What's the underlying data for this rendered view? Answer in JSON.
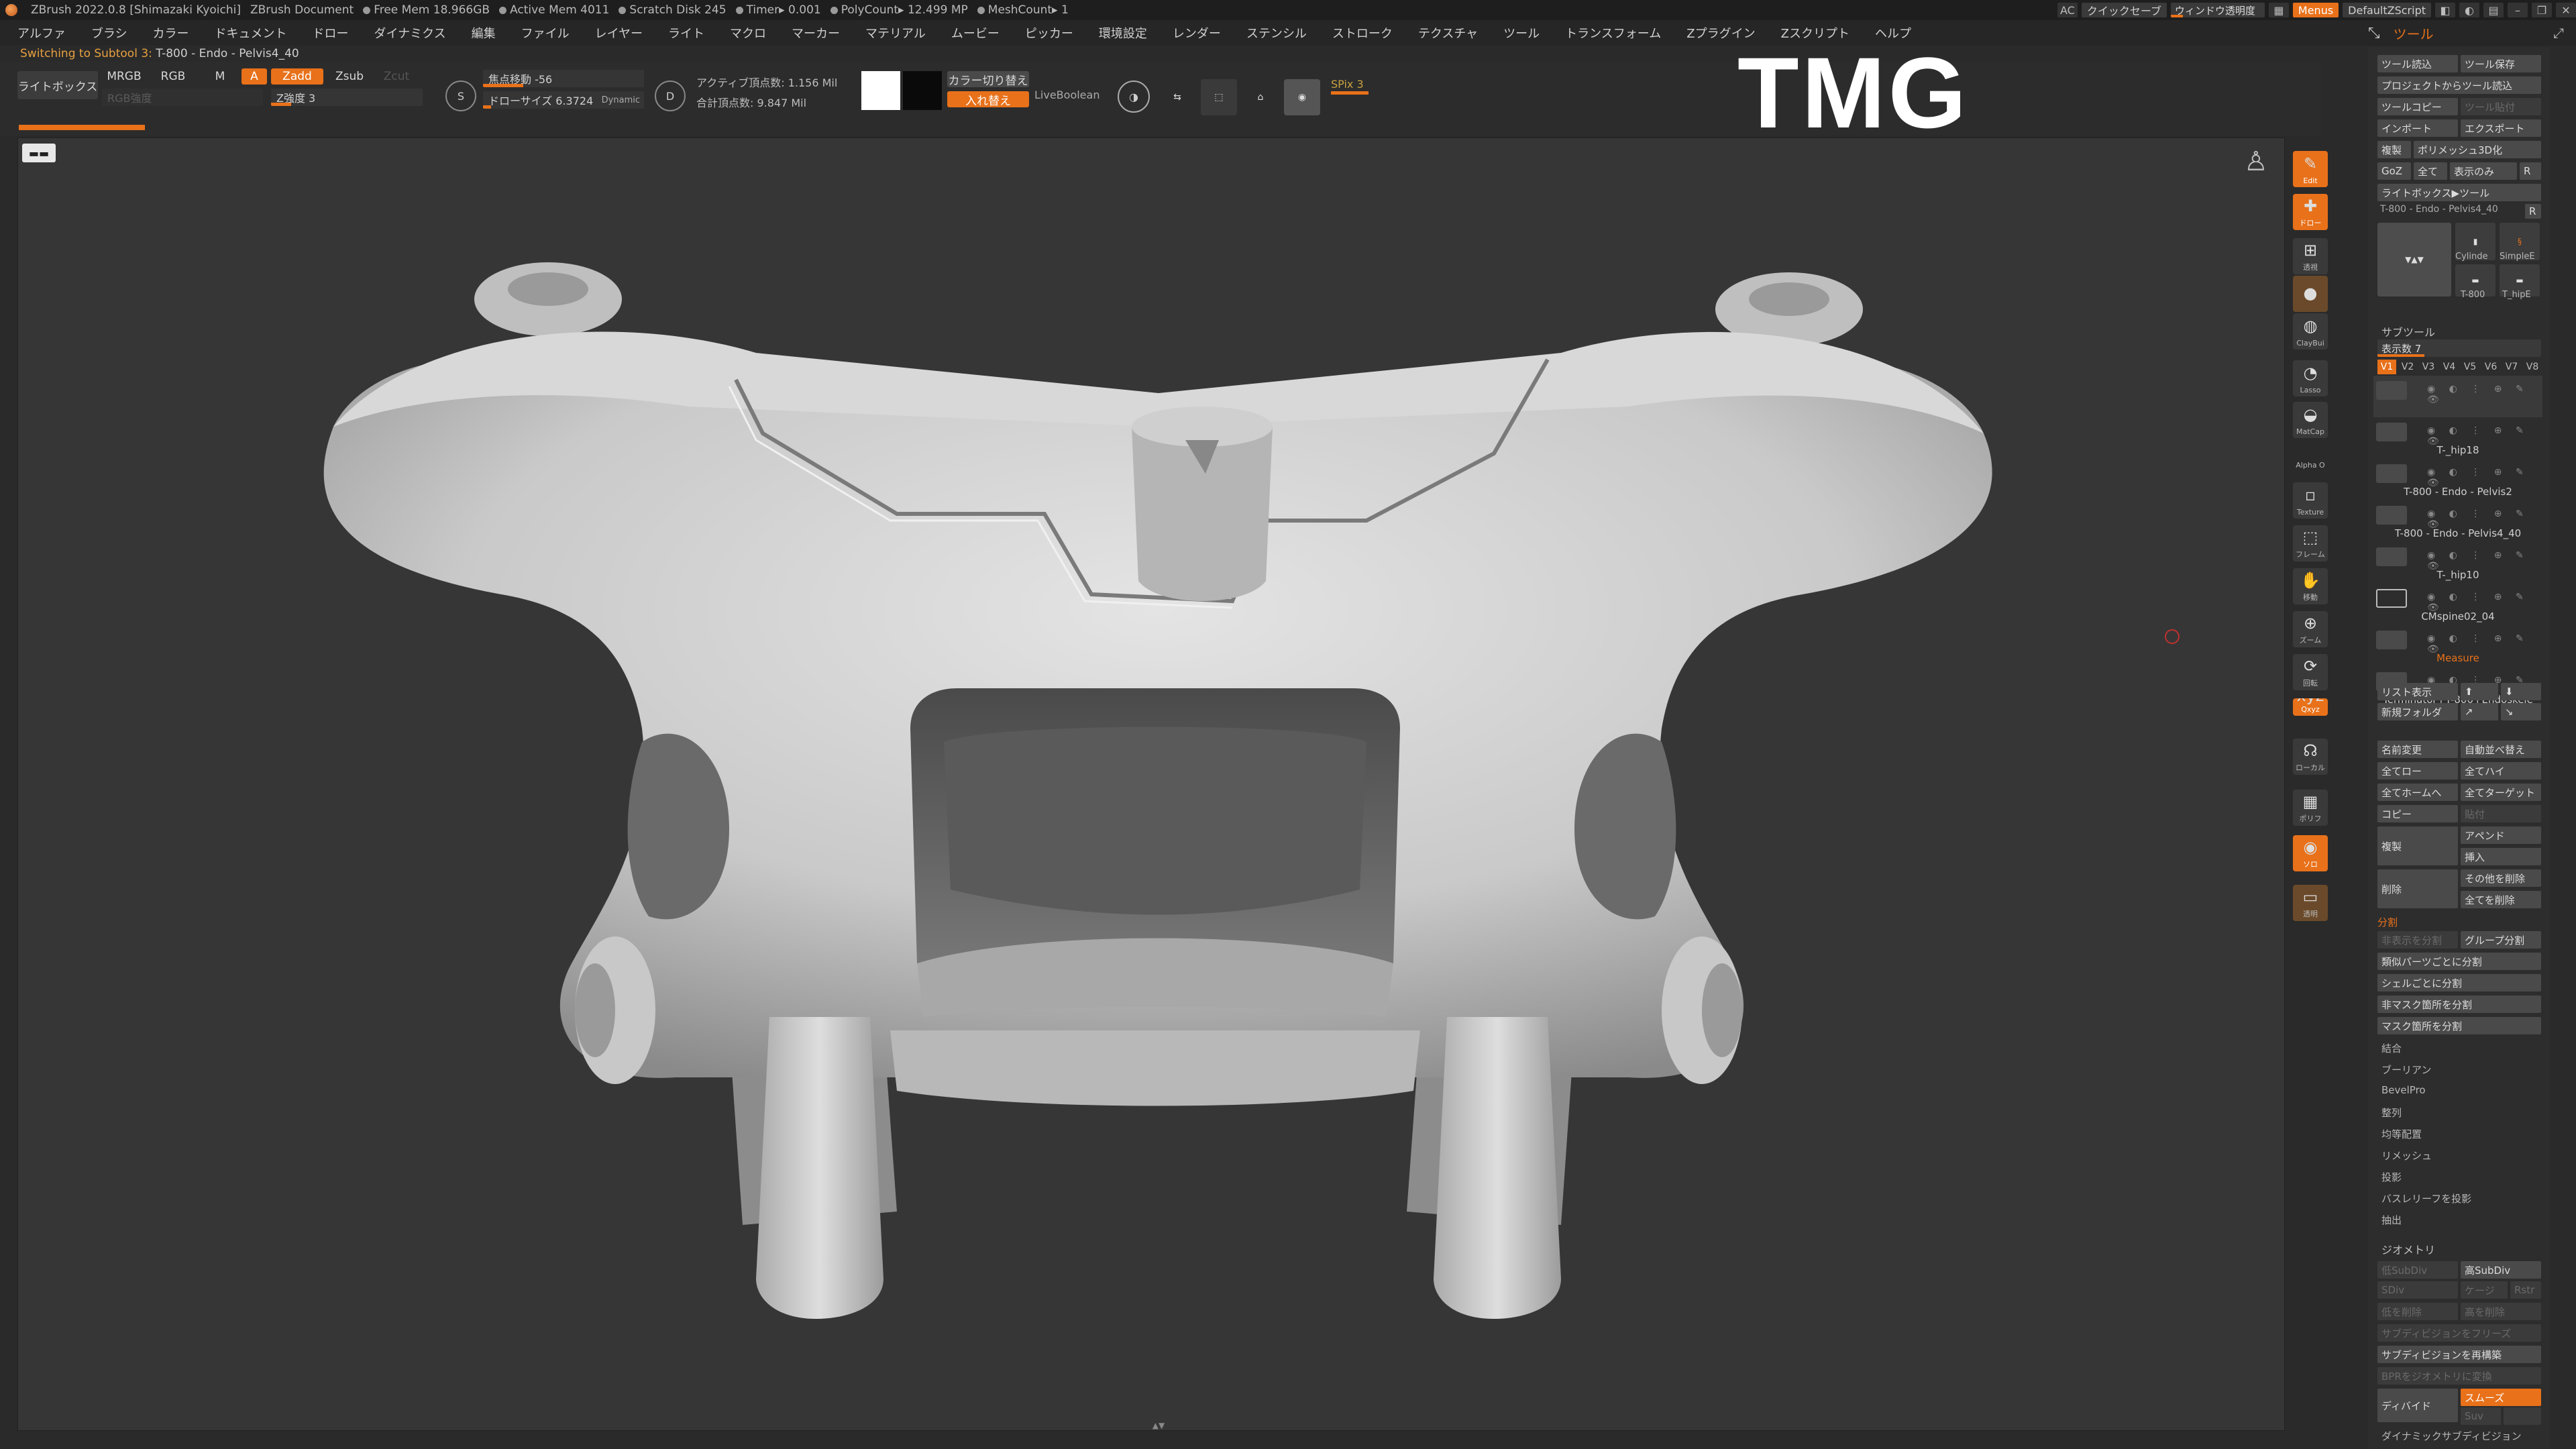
{
  "titlebar": {
    "app": "ZBrush 2022.0.8 [Shimazaki Kyoichi]",
    "doc": "ZBrush Document",
    "free_mem": "Free Mem 18.966GB",
    "active_mem": "Active Mem 4011",
    "scratch": "Scratch Disk 245",
    "timer": "Timer▸ 0.001",
    "polycount": "PolyCount▸ 12.499 MP",
    "meshcount": "MeshCount▸ 1",
    "quicksave": "クイックセーブ",
    "transparency": "ウィンドウ透明度",
    "menus": "Menus",
    "zscript": "DefaultZScript"
  },
  "menubar": [
    "アルファ",
    "ブラシ",
    "カラー",
    "ドキュメント",
    "ドロー",
    "ダイナミクス",
    "編集",
    "ファイル",
    "レイヤー",
    "ライト",
    "マクロ",
    "マーカー",
    "マテリアル",
    "ムービー",
    "ピッカー",
    "環境設定",
    "レンダー",
    "ステンシル",
    "ストローク",
    "テクスチャ",
    "ツール",
    "トランスフォーム",
    "Zプラグイン",
    "Zスクリプト",
    "ヘルプ"
  ],
  "tool_header": {
    "label": "ツール"
  },
  "switching": {
    "prefix": "Switching to Subtool 3:",
    "name": "T-800 - Endo - Pelvis4_40"
  },
  "toolbar": {
    "lightbox": "ライトボックス",
    "mrgb": "MRGB",
    "rgb": "RGB",
    "m": "M",
    "a": "A",
    "zadd": "Zadd",
    "zsub": "Zsub",
    "zcut": "Zcut",
    "rgb_intensity_label": "RGB強度",
    "z_intensity": "Z強度 3",
    "focal_shift": "焦点移動 -56",
    "draw_size": "ドローサイズ 6.3724",
    "dynamic": "Dynamic",
    "active_points": "アクティブ頂点数: 1.156 Mil",
    "total_points": "合計頂点数: 9.847 Mil",
    "switch_color": "カラー切り替え",
    "swap": "入れ替え",
    "live_boolean": "LiveBoolean",
    "spix": "SPix 3",
    "s_label": "S",
    "d_label": "D"
  },
  "watermark": {
    "text": "TMG"
  },
  "progress": {
    "value": 0.055
  },
  "shelf": [
    {
      "name": "edit",
      "label": "Edit"
    },
    {
      "name": "draw",
      "label": "ドロー"
    },
    {
      "name": "perspective",
      "label": "透視"
    },
    {
      "name": "brush",
      "label": ""
    },
    {
      "name": "claybuildup",
      "label": "ClayBui"
    },
    {
      "name": "lasso",
      "label": "Lasso"
    },
    {
      "name": "matcap",
      "label": "MatCap"
    },
    {
      "name": "alpha",
      "label": "Alpha O"
    },
    {
      "name": "texture",
      "label": "Texture"
    },
    {
      "name": "frame",
      "label": "フレーム"
    },
    {
      "name": "move",
      "label": "移動"
    },
    {
      "name": "scale",
      "label": "ズーム"
    },
    {
      "name": "rotate",
      "label": "回転"
    },
    {
      "name": "xyz",
      "label": "Qxyz"
    },
    {
      "name": "local",
      "label": "ローカル"
    },
    {
      "name": "polyframe",
      "label": "ポリフ"
    },
    {
      "name": "solo",
      "label": "ソロ"
    },
    {
      "name": "transp",
      "label": "透明"
    }
  ],
  "panel": {
    "load_tool": "ツール読込",
    "save_tool": "ツール保存",
    "load_from_project": "プロジェクトからツール読込",
    "copy_tool": "ツールコピー",
    "paste_tool": "ツール貼付",
    "import": "インポート",
    "export": "エクスポート",
    "clone": "複製",
    "make_polymesh": "ポリメッシュ3D化",
    "goz": "GoZ",
    "all": "全て",
    "visible": "表示のみ",
    "r": "R",
    "lightbox_tools": "ライトボックス▶ツール",
    "current_tool": "T-800 - Endo - Pelvis4_40",
    "r2": "R",
    "thumb_cyl": "Cylinde",
    "thumb_simple": "SimpleE",
    "thumb_t800": "T-800",
    "thumb_hip": "T_hipE",
    "subtool_header": "サブツール",
    "visible_count": "表示数 7",
    "vtabs": [
      "V1",
      "V2",
      "V3",
      "V4",
      "V5",
      "V6",
      "V7",
      "V8"
    ],
    "subtools": [
      "",
      "T-_hip18",
      "T-800 - Endo - Pelvis2",
      "T-800 - Endo - Pelvis4_40",
      "T-_hip10",
      "CMspine02_04",
      "Measure",
      "Terminator+T-800+Endoskele"
    ],
    "list_view": "リスト表示",
    "new_folder": "新規フォルダ",
    "rename": "名前変更",
    "autoreorder": "自動並べ替え",
    "all_low": "全てロー",
    "all_high": "全てハイ",
    "all_to_home": "全てホームへ",
    "all_to_target": "全てターゲット",
    "copy": "コピー",
    "paste": "貼付",
    "duplicate": "複製",
    "append": "アペンド",
    "insert": "挿入",
    "delete": "削除",
    "delete_other": "その他を削除",
    "delete_all": "全てを削除",
    "split_header": "分割",
    "split_hidden": "非表示を分割",
    "group_split": "グループ分割",
    "split_similar": "類似パーツごとに分割",
    "split_shells": "シェルごとに分割",
    "split_unmasked": "非マスク箇所を分割",
    "split_masked": "マスク箇所を分割",
    "merge": "結合",
    "boolean": "ブーリアン",
    "bevelpro": "BevelPro",
    "align": "整列",
    "distribute": "均等配置",
    "remesh": "リメッシュ",
    "project": "投影",
    "project_bas": "バスレリーフを投影",
    "extract": "抽出",
    "geometry_header": "ジオメトリ",
    "lower_res": "低SubDiv",
    "higher_res": "高SubDiv",
    "sdiv": "SDiv",
    "cage": "ケージ",
    "rstr": "Rstr",
    "del_lower": "低を削除",
    "del_higher": "高を削除",
    "freeze_subdiv": "サブディビジョンをフリーズ",
    "reconstruct": "サブディビジョンを再構築",
    "convert_bpr": "BPRをジオメトリに変換",
    "divide": "ディバイド",
    "smooth": "スムーズ",
    "suv": "Suv",
    "dynamic_subdiv": "ダイナミックサブディビジョン"
  }
}
